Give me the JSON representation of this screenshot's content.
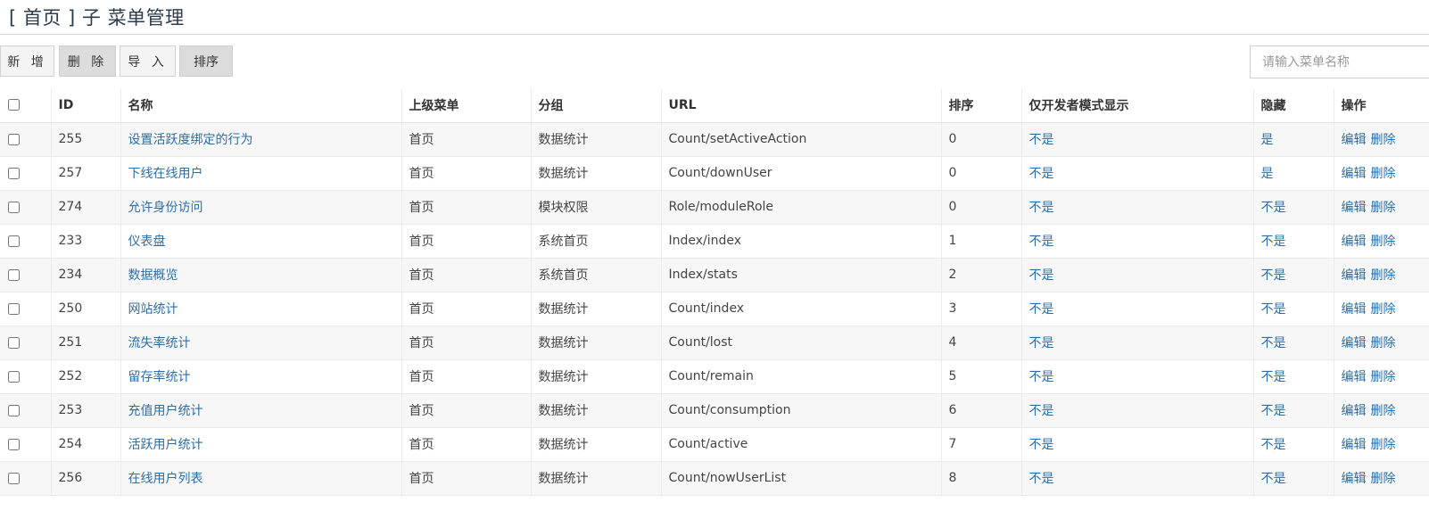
{
  "header": {
    "title": "[ 首页 ] 子 菜单管理"
  },
  "toolbar": {
    "add_label": "新 增",
    "delete_label": "删 除",
    "import_label": "导 入",
    "sort_label": "排序",
    "search_placeholder": "请输入菜单名称"
  },
  "table": {
    "columns": [
      "ID",
      "名称",
      "上级菜单",
      "分组",
      "URL",
      "排序",
      "仅开发者模式显示",
      "隐藏",
      "操作"
    ],
    "edit_label": "编辑",
    "delete_label": "删除",
    "rows": [
      {
        "id": "255",
        "name": "设置活跃度绑定的行为",
        "parent": "首页",
        "group": "数据统计",
        "url": "Count/setActiveAction",
        "sort": "0",
        "dev_only": "不是",
        "hidden": "是"
      },
      {
        "id": "257",
        "name": "下线在线用户",
        "parent": "首页",
        "group": "数据统计",
        "url": "Count/downUser",
        "sort": "0",
        "dev_only": "不是",
        "hidden": "是"
      },
      {
        "id": "274",
        "name": "允许身份访问",
        "parent": "首页",
        "group": "模块权限",
        "url": "Role/moduleRole",
        "sort": "0",
        "dev_only": "不是",
        "hidden": "不是"
      },
      {
        "id": "233",
        "name": "仪表盘",
        "parent": "首页",
        "group": "系统首页",
        "url": "Index/index",
        "sort": "1",
        "dev_only": "不是",
        "hidden": "不是"
      },
      {
        "id": "234",
        "name": "数据概览",
        "parent": "首页",
        "group": "系统首页",
        "url": "Index/stats",
        "sort": "2",
        "dev_only": "不是",
        "hidden": "不是"
      },
      {
        "id": "250",
        "name": "网站统计",
        "parent": "首页",
        "group": "数据统计",
        "url": "Count/index",
        "sort": "3",
        "dev_only": "不是",
        "hidden": "不是"
      },
      {
        "id": "251",
        "name": "流失率统计",
        "parent": "首页",
        "group": "数据统计",
        "url": "Count/lost",
        "sort": "4",
        "dev_only": "不是",
        "hidden": "不是"
      },
      {
        "id": "252",
        "name": "留存率统计",
        "parent": "首页",
        "group": "数据统计",
        "url": "Count/remain",
        "sort": "5",
        "dev_only": "不是",
        "hidden": "不是"
      },
      {
        "id": "253",
        "name": "充值用户统计",
        "parent": "首页",
        "group": "数据统计",
        "url": "Count/consumption",
        "sort": "6",
        "dev_only": "不是",
        "hidden": "不是"
      },
      {
        "id": "254",
        "name": "活跃用户统计",
        "parent": "首页",
        "group": "数据统计",
        "url": "Count/active",
        "sort": "7",
        "dev_only": "不是",
        "hidden": "不是"
      },
      {
        "id": "256",
        "name": "在线用户列表",
        "parent": "首页",
        "group": "数据统计",
        "url": "Count/nowUserList",
        "sort": "8",
        "dev_only": "不是",
        "hidden": "不是"
      }
    ]
  },
  "colors": {
    "link": "#2e6da4",
    "title": "#2b3b4c",
    "row_stripe": "#f7f7f7"
  }
}
